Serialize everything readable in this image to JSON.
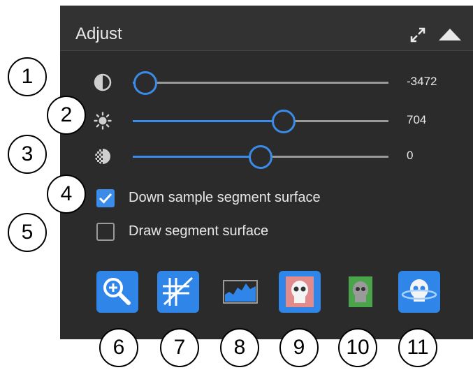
{
  "panel": {
    "title": "Adjust",
    "icons": [
      "expand-icon",
      "collapse-up-icon"
    ]
  },
  "sliders": [
    {
      "icon": "contrast-icon",
      "value_text": "-3472",
      "position_fraction": 0.05
    },
    {
      "icon": "brightness-icon",
      "value_text": "704",
      "position_fraction": 0.59
    },
    {
      "icon": "opacity-icon",
      "value_text": "0",
      "position_fraction": 0.5
    }
  ],
  "checkboxes": [
    {
      "label": "Down sample segment surface",
      "checked": true
    },
    {
      "label": "Draw segment surface",
      "checked": false
    }
  ],
  "toolbar": [
    "zoom-reset-icon",
    "crosshatch-icon",
    "histogram-icon",
    "skull-red-icon",
    "skull-green-icon",
    "skull-rotate-icon"
  ],
  "callouts": [
    "1",
    "2",
    "3",
    "4",
    "5",
    "6",
    "7",
    "8",
    "9",
    "10",
    "11"
  ],
  "colors": {
    "accent": "#3b8be8",
    "panel_bg": "#2b2b2b",
    "text": "#e8e8e8"
  }
}
